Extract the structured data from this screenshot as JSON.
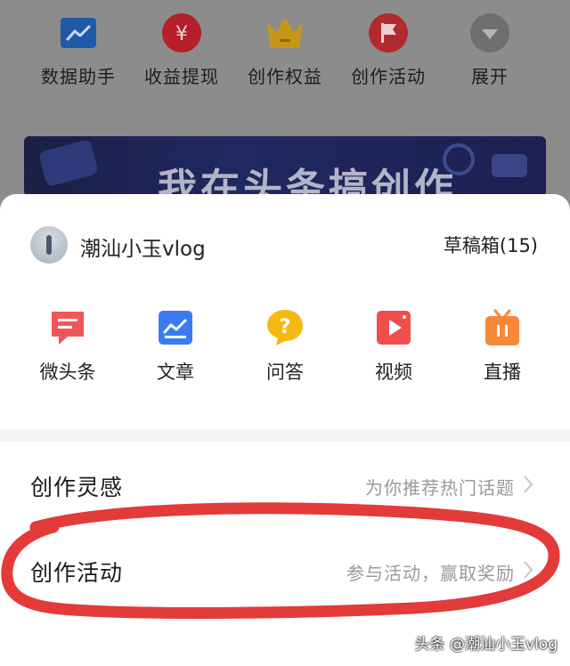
{
  "top_tools": [
    {
      "label": "数据助手",
      "icon": "chart-icon",
      "color": "#1f5aa8"
    },
    {
      "label": "收益提现",
      "icon": "yen-icon",
      "color": "#b5202a"
    },
    {
      "label": "创作权益",
      "icon": "crown-icon",
      "color": "#c79616"
    },
    {
      "label": "创作活动",
      "icon": "flag-icon",
      "color": "#b12a2e"
    },
    {
      "label": "展开",
      "icon": "expand-icon",
      "color": "#6f6f6f"
    }
  ],
  "banner": {
    "text": "我在头条搞创作"
  },
  "profile": {
    "name": "潮汕小玉vlog",
    "drafts": "草稿箱(15)"
  },
  "create_items": [
    {
      "label": "微头条",
      "icon": "micro-post-icon",
      "color": "#f0575a"
    },
    {
      "label": "文章",
      "icon": "article-icon",
      "color": "#3a7cf0"
    },
    {
      "label": "问答",
      "icon": "qa-icon",
      "color": "#f6b812"
    },
    {
      "label": "视频",
      "icon": "video-icon",
      "color": "#f04d4d"
    },
    {
      "label": "直播",
      "icon": "live-icon",
      "color": "#f7883a"
    }
  ],
  "list_rows": [
    {
      "title": "创作灵感",
      "hint": "为你推荐热门话题"
    },
    {
      "title": "创作活动",
      "hint": "参与活动，赢取奖励"
    }
  ],
  "watermark": "头条 @潮汕小玉vlog",
  "annotation_color": "#e33a3a"
}
